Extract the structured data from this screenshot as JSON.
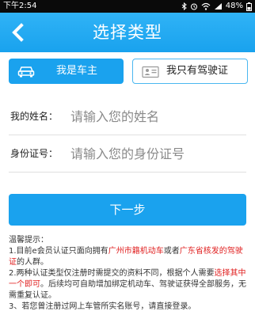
{
  "status_bar": {
    "time": "下午2:54",
    "battery": "48%",
    "icons": [
      "bluetooth-icon",
      "alarm-icon",
      "wifi-icon",
      "signal-icon",
      "battery-icon"
    ]
  },
  "header": {
    "title": "选择类型",
    "back_icon": "chevron-left-icon",
    "background": "#1aa2ee"
  },
  "type_tabs": [
    {
      "label": "我是车主",
      "icon": "car-icon",
      "selected": true
    },
    {
      "label": "我只有驾驶证",
      "icon": "id-card-icon",
      "selected": false
    }
  ],
  "form": {
    "name_label": "我的姓名：",
    "name_placeholder": "请输入您的姓名",
    "id_label": "身份证号：",
    "id_placeholder": "请输入您的身份证号"
  },
  "next_button": "下一步",
  "tips": {
    "title": "温馨提示：",
    "line1_a": "1.目前e会员认证只面向拥有",
    "line1_red1": "广州市籍机动车",
    "line1_b": "或者",
    "line1_red2": "广东省核发的驾驶证",
    "line1_c": "的人群。",
    "line2_a": "2.两种认证类型仅注册时需提交的资料不同，根据个人需要",
    "line2_red": "选择其中一个即可",
    "line2_b": "。后续均可自助增加绑定机动车、驾驶证获得全部服务，无需重复认证。",
    "line3": "3、若您曾注册过网上车管所实名账号，请直接登录。"
  },
  "colors": {
    "accent": "#1aa2ee",
    "warning_text": "#e02020"
  }
}
